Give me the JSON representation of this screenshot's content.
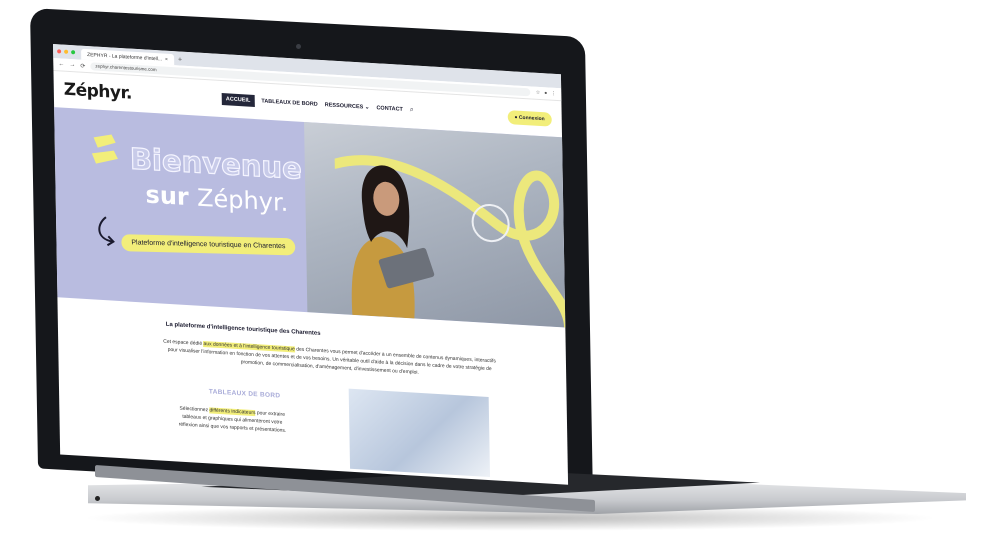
{
  "browser": {
    "tab_title": "ZEPHYR - La plateforme d'intell...",
    "new_tab": "+",
    "url": "zephyr.charentestourisme.com",
    "nav_back": "←",
    "nav_forward": "→",
    "nav_reload": "⟳"
  },
  "site": {
    "logo": "Zéphyr.",
    "nav": [
      {
        "label": "ACCUEIL"
      },
      {
        "label": "TABLEAUX DE BORD"
      },
      {
        "label": "RESSOURCES ⌄"
      },
      {
        "label": "CONTACT"
      }
    ],
    "connect_label": "Connexion"
  },
  "hero": {
    "title_line1": "Bienvenue",
    "title_line2_prefix": "sur",
    "title_line2_brand": "Zéphyr.",
    "tagline": "Plateforme d'intelligence touristique en Charentes"
  },
  "intro": {
    "heading": "La plateforme d'intelligence touristique des Charentes",
    "text_before": "Cet espace dédié",
    "highlight": "aux données et à l'intelligence touristique",
    "text_after": "des Charentes vous permet d'accéder à un ensemble de contenus dynamiques, interactifs pour visualiser l'information en fonction de vos attentes et de vos besoins. Un véritable outil d'aide à la décision dans le cadre de votre stratégie de promotion, de commercialisation, d'aménagement, d'investissement ou d'emploi."
  },
  "boards": {
    "title": "TABLEAUX DE BORD",
    "text_before": "Sélectionnez",
    "highlight": "différents indicateurs",
    "text_after": "pour extraire tableaux et graphiques qui alimenteront votre réflexion ainsi que vos rapports et présentations."
  },
  "colors": {
    "accent_yellow": "#f2ee7a",
    "hero_lavender": "#b9bce0",
    "nav_active": "#24273a"
  }
}
